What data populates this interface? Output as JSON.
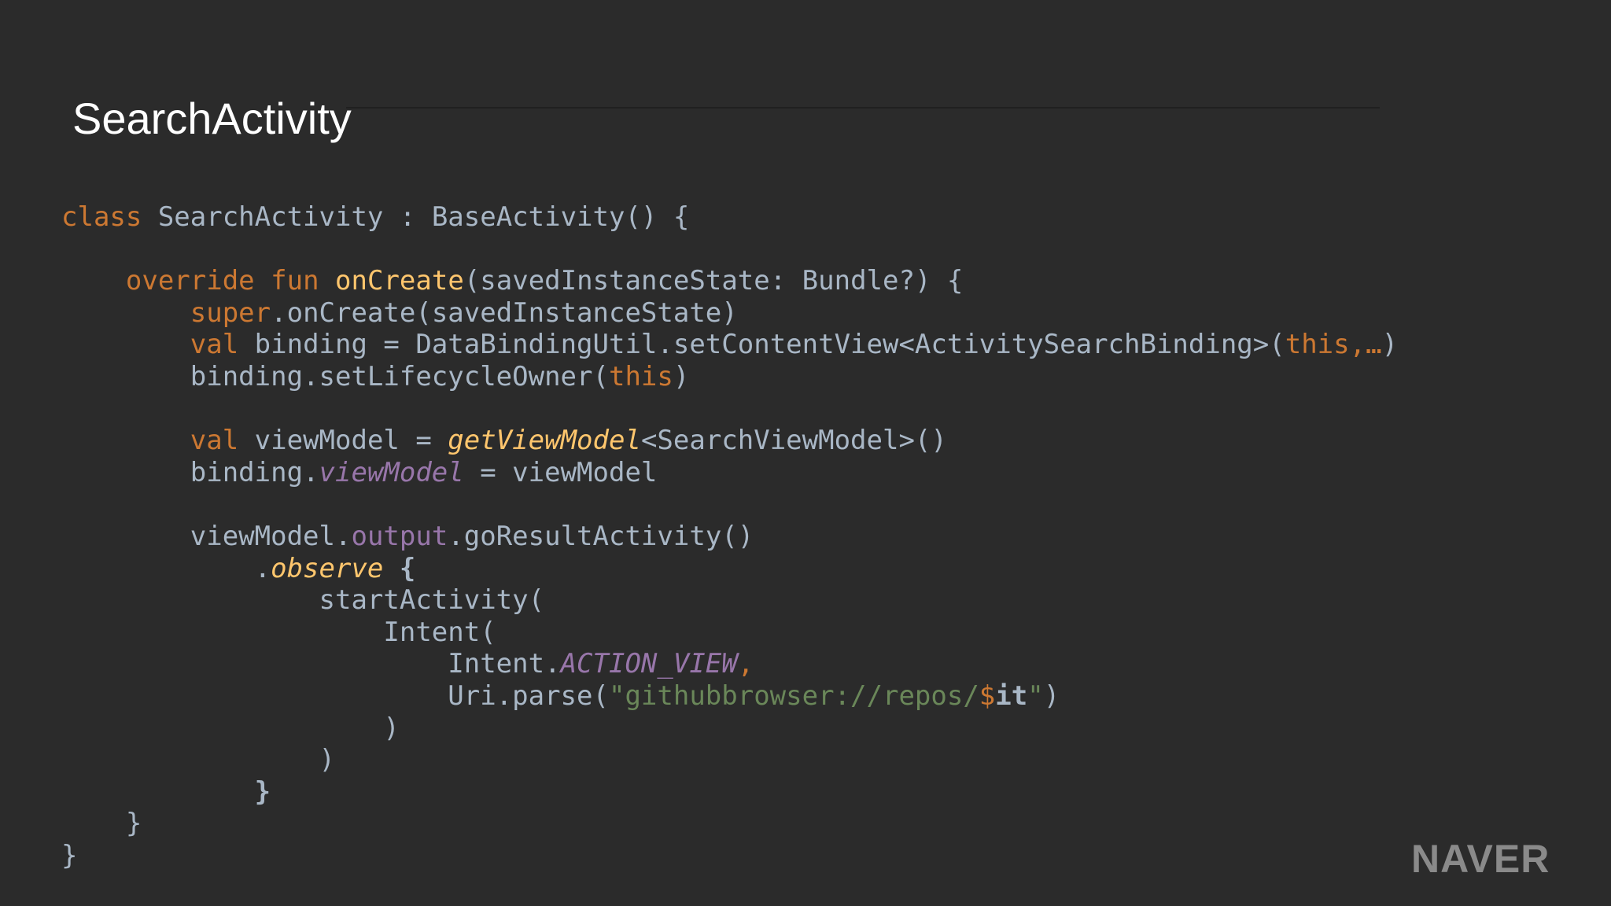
{
  "slide": {
    "title": "SearchActivity",
    "logo_text": "NAVER"
  },
  "colors": {
    "background": "#2b2b2b",
    "keyword": "#cc7832",
    "default_text": "#a9b7c6",
    "function": "#ffc66d",
    "field": "#9876aa",
    "string": "#6a8759"
  },
  "code_lines": [
    [
      {
        "t": "class",
        "c": "kw"
      },
      {
        "t": " SearchActivity : BaseActivity() {"
      }
    ],
    [],
    [
      {
        "t": "    "
      },
      {
        "t": "override",
        "c": "kw"
      },
      {
        "t": " "
      },
      {
        "t": "fun",
        "c": "kw"
      },
      {
        "t": " "
      },
      {
        "t": "onCreate",
        "c": "fn"
      },
      {
        "t": "(savedInstanceState: Bundle?) {"
      }
    ],
    [
      {
        "t": "        "
      },
      {
        "t": "super",
        "c": "kw"
      },
      {
        "t": ".onCreate(savedInstanceState)"
      }
    ],
    [
      {
        "t": "        "
      },
      {
        "t": "val",
        "c": "kw"
      },
      {
        "t": " binding = DataBindingUtil.setContentView<ActivitySearchBinding>("
      },
      {
        "t": "this",
        "c": "kw"
      },
      {
        "t": ",…",
        "c": "kw"
      },
      {
        "t": ")"
      }
    ],
    [
      {
        "t": "        binding.setLifecycleOwner("
      },
      {
        "t": "this",
        "c": "kw"
      },
      {
        "t": ")"
      }
    ],
    [],
    [
      {
        "t": "        "
      },
      {
        "t": "val",
        "c": "kw"
      },
      {
        "t": " viewModel = "
      },
      {
        "t": "getViewModel",
        "c": "fni"
      },
      {
        "t": "<SearchViewModel>()"
      }
    ],
    [
      {
        "t": "        binding."
      },
      {
        "t": "viewModel",
        "c": "fli"
      },
      {
        "t": " = viewModel"
      }
    ],
    [],
    [
      {
        "t": "        viewModel."
      },
      {
        "t": "output",
        "c": "fld"
      },
      {
        "t": ".goResultActivity()"
      }
    ],
    [
      {
        "t": "            ."
      },
      {
        "t": "observe",
        "c": "fni"
      },
      {
        "t": " "
      },
      {
        "t": "{",
        "c": "bld"
      }
    ],
    [
      {
        "t": "                startActivity("
      }
    ],
    [
      {
        "t": "                    Intent("
      }
    ],
    [
      {
        "t": "                        Intent."
      },
      {
        "t": "ACTION_VIEW",
        "c": "fli"
      },
      {
        "t": ",",
        "c": "kw"
      }
    ],
    [
      {
        "t": "                        Uri.parse("
      },
      {
        "t": "\"githubbrowser://repos/",
        "c": "str"
      },
      {
        "t": "$",
        "c": "kw"
      },
      {
        "t": "it",
        "c": "bld"
      },
      {
        "t": "\"",
        "c": "str"
      },
      {
        "t": ")"
      }
    ],
    [
      {
        "t": "                    )"
      }
    ],
    [
      {
        "t": "                )"
      }
    ],
    [
      {
        "t": "            "
      },
      {
        "t": "}",
        "c": "bld"
      }
    ],
    [
      {
        "t": "    }"
      }
    ],
    [
      {
        "t": "}"
      }
    ]
  ]
}
